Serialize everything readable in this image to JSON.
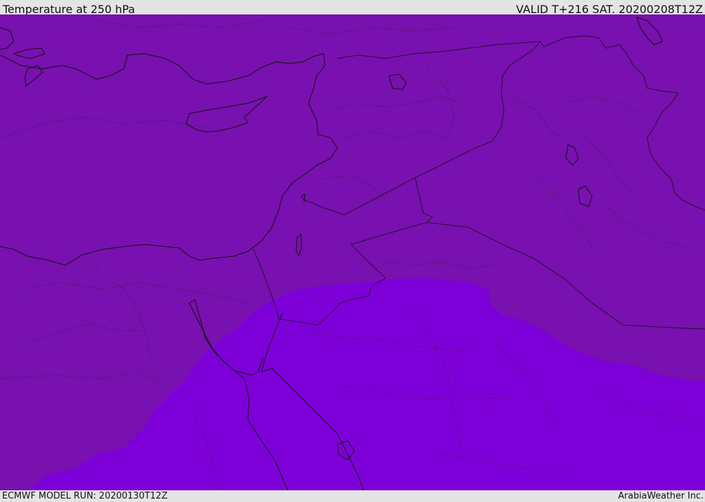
{
  "header": {
    "title": "Temperature at 250 hPa",
    "valid": "VALID T+216 SAT. 20200208T12Z"
  },
  "footer": {
    "model_run": "ECMWF MODEL RUN: 20200130T12Z",
    "credit": "ArabiaWeather Inc."
  },
  "map": {
    "colors": {
      "background_fill": "#7811af",
      "colder_fill": "#7e00d8",
      "coastline": "#111111",
      "border": "#111111"
    }
  }
}
